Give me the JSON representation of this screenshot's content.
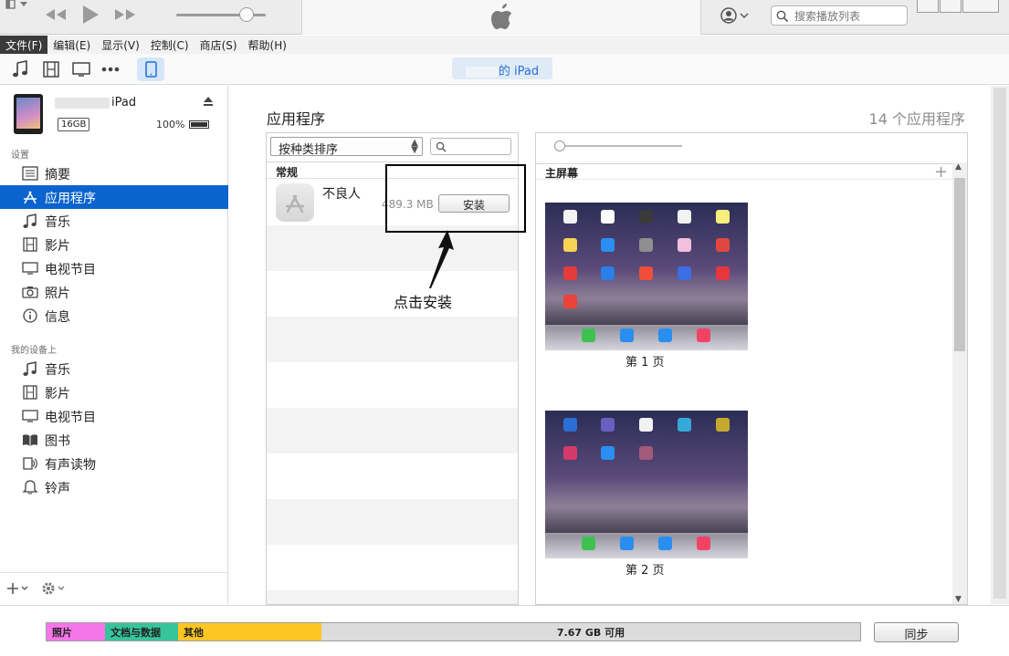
{
  "menubar": {
    "items": [
      "文件(F)",
      "编辑(E)",
      "显示(V)",
      "控制(C)",
      "商店(S)",
      "帮助(H)"
    ]
  },
  "search": {
    "placeholder": "搜索播放列表"
  },
  "toolbar": {
    "device_pill": "的 iPad"
  },
  "device": {
    "name": "iPad",
    "capacity": "16GB",
    "battery": "100%"
  },
  "sidebar": {
    "settings_label": "设置",
    "settings_items": [
      {
        "label": "摘要",
        "icon": "summary-icon"
      },
      {
        "label": "应用程序",
        "icon": "apps-icon",
        "selected": true
      },
      {
        "label": "音乐",
        "icon": "music-icon"
      },
      {
        "label": "影片",
        "icon": "film-icon"
      },
      {
        "label": "电视节目",
        "icon": "tv-icon"
      },
      {
        "label": "照片",
        "icon": "camera-icon"
      },
      {
        "label": "信息",
        "icon": "info-icon"
      }
    ],
    "ondevice_label": "我的设备上",
    "ondevice_items": [
      {
        "label": "音乐",
        "icon": "music-icon"
      },
      {
        "label": "影片",
        "icon": "film-icon"
      },
      {
        "label": "电视节目",
        "icon": "tv-icon"
      },
      {
        "label": "图书",
        "icon": "book-icon"
      },
      {
        "label": "有声读物",
        "icon": "audiobook-icon"
      },
      {
        "label": "铃声",
        "icon": "bell-icon"
      }
    ]
  },
  "main": {
    "title": "应用程序",
    "count": "14 个应用程序",
    "sort_label": "按种类排序",
    "list_header": "常规",
    "app": {
      "name": "不良人",
      "size": "489.3 MB",
      "install_label": "安装"
    },
    "screens_header": "主屏幕",
    "pages": [
      "第 1 页",
      "第 2 页"
    ]
  },
  "annotation": {
    "text": "点击安装"
  },
  "footer": {
    "segments": [
      {
        "label": "照片",
        "color": "#f576e9"
      },
      {
        "label": "文档与数据",
        "color": "#37c49b"
      },
      {
        "label": "其他",
        "color": "#fcc624"
      }
    ],
    "free": "7.67 GB 可用",
    "sync_label": "同步"
  },
  "colors": {
    "selection": "#0b63ce",
    "accent": "#2a6fd6"
  }
}
